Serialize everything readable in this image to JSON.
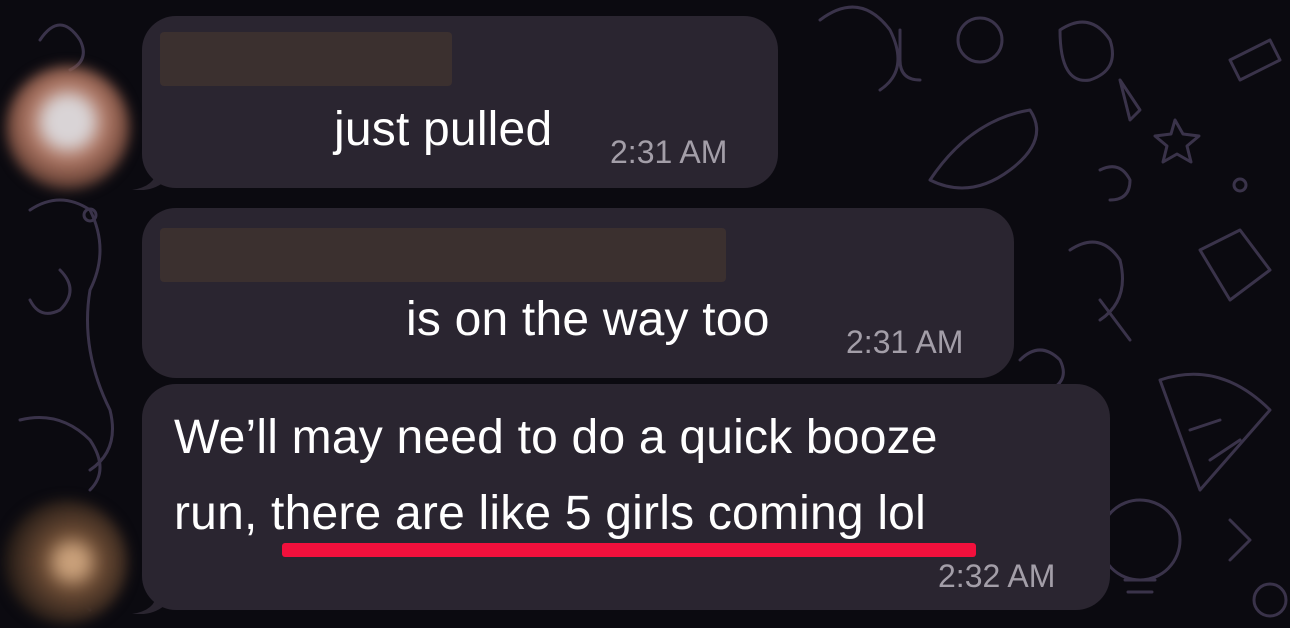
{
  "messages": [
    {
      "text": "just pulled",
      "time": "2:31 AM"
    },
    {
      "text": "is on the way too",
      "time": "2:31 AM"
    },
    {
      "line1": "We’ll may need to do a quick booze",
      "line2_pre": "run, ",
      "line2_highlight": "there are like 5 girls coming",
      "line2_post": " lol",
      "time": "2:32 AM"
    }
  ],
  "colors": {
    "background": "#0b0a10",
    "bubble": "#2a2530",
    "time_text": "#a39ea8",
    "highlight_underline": "#f2103c"
  }
}
